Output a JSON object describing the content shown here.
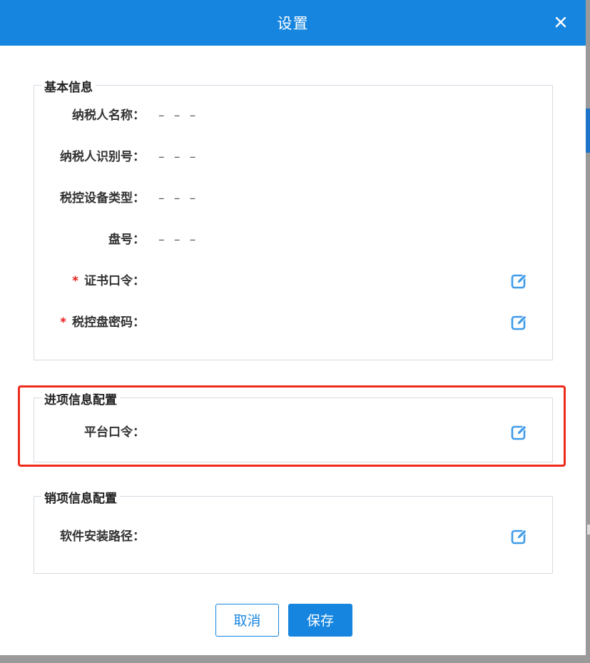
{
  "dialog": {
    "title": "设置",
    "close_icon": "close-icon"
  },
  "basic": {
    "legend": "基本信息",
    "rows": [
      {
        "label": "纳税人名称：",
        "value": "– – –"
      },
      {
        "label": "纳税人识别号：",
        "value": "– – –"
      },
      {
        "label": "税控设备类型：",
        "value": "– – –"
      },
      {
        "label": "盘号：",
        "value": "– – –"
      },
      {
        "required": "*",
        "label": "证书口令：",
        "icon": "edit-icon"
      },
      {
        "required": "*",
        "label": "税控盘密码：",
        "icon": "edit-icon"
      }
    ]
  },
  "input_config": {
    "legend": "进项信息配置",
    "rows": [
      {
        "label": "平台口令：",
        "icon": "edit-icon"
      }
    ]
  },
  "output_config": {
    "legend": "销项信息配置",
    "rows": [
      {
        "label": "软件安装路径：",
        "icon": "edit-icon"
      }
    ]
  },
  "footer": {
    "cancel_label": "取消",
    "save_label": "保存"
  },
  "colors": {
    "primary": "#1585e0",
    "required": "#e51d1d",
    "highlight": "#ee2a1c",
    "edit_icon": "#3d9be9"
  }
}
